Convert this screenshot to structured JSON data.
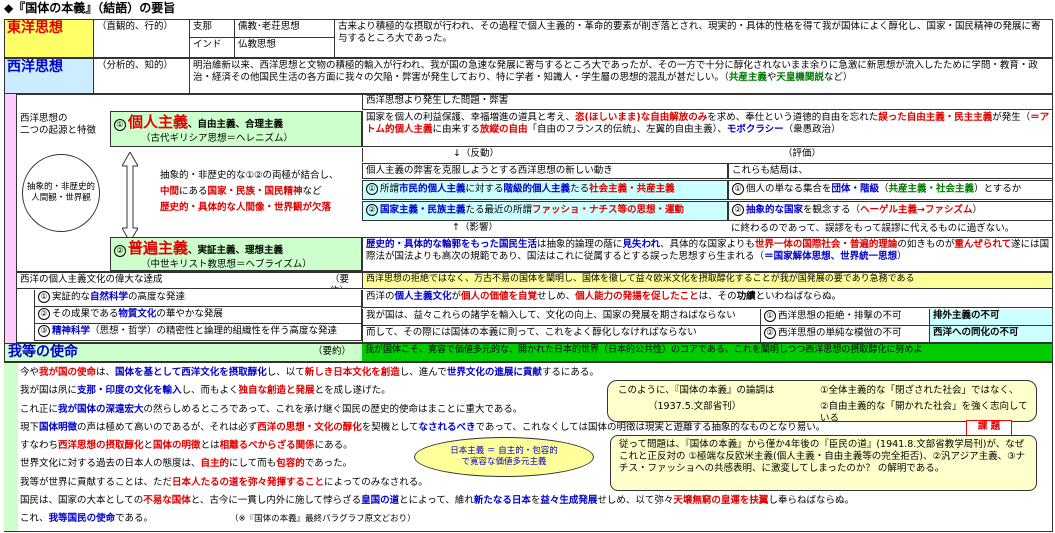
{
  "title": "◆『国体の本義』（結語）の要旨",
  "east": {
    "label": "東洋思想",
    "type": "（直観的、行的）",
    "regions": [
      "支那",
      "インド"
    ],
    "schools": [
      "儒教･老荘思想",
      "仏教思想"
    ],
    "text": "古来より積極的な摂取が行われ、その過程で個人主義的・革命的要素が削ぎ落とされ、現実的・具体的性格を得て我が国体によく醇化し、国家・国民精神の発展に寄与するところ大であった。"
  },
  "west": {
    "label": "西洋思想",
    "type": "（分析的、知的）",
    "text_a": "明治維新以来、西洋思想と文物の積極的輸入が行われ、我が国の急速な発展に寄与するところ大であったが、その一方で十分に醇化されないまま余りに急激に新思想が流入したために学問・教育・政治・経済その他国民生活の各方面に我々の欠陥・弊害が発生しており、特に学者・知識人・学生層の思想的混乱が甚だしい。（",
    "text_b": "共産主義",
    "text_c": "や",
    "text_d": "天皇機関説",
    "text_e": "など）"
  },
  "problems_header": "西洋思想より発生した問題・弊害",
  "origins_label_1": "西洋思想の",
  "origins_label_2": "二つの起源と特徴",
  "circle_text": [
    "抽象的・非歴史的",
    "人間観・世界観"
  ],
  "individualism": {
    "num": "①",
    "name": "個人主義",
    "sub": "、自由主義、合理主義",
    "origin": "（古代ギリシア思想＝ヘレニズム）",
    "problem_a": "国家を個人の利益保護、幸福増進の道具と考え、",
    "problem_b": "恣(ほしいまま)な自由解放のみ",
    "problem_c": "を求め、奉仕という道徳的自由を忘れた",
    "problem_d": "誤った自由主義・民主主義",
    "problem_e": "が発生（",
    "problem_f": "＝アトム的個人主義",
    "problem_g": "に由来する",
    "problem_h": "放縦の自由",
    "problem_i": "「自由のフランス的伝統」、左翼的自由主義）、",
    "problem_j": "モボクラシー",
    "problem_k": "（衆愚政治）"
  },
  "middle": {
    "line1": "抽象的・非歴史的な①②の両極が結合し、",
    "line2a": "中間",
    "line2b": "にある",
    "line2c": "国家・民族・国民精神",
    "line2d": "など",
    "line3a": "歴史的・具体的な人間像・世界観が欠落"
  },
  "reaction": {
    "label": "↓（反動）",
    "sub": "個人主義の弊害を克服しようとする西洋思想の新しい動き",
    "row1_num": "①",
    "row1_a": "所謂",
    "row1_b": "市民的個人主義",
    "row1_c": "に対する",
    "row1_d": "階級的個人主義",
    "row1_e": "たる",
    "row1_f": "社会主義・共産主義",
    "row2_num": "②",
    "row2_a": "国家主義・民族主義",
    "row2_b": "たる最近の所謂",
    "row2_c": "ファッショ・ナチス等の思想・運動",
    "influence": "↑（影響）"
  },
  "evaluation": {
    "label": "（評価）",
    "sub": "これらも結局は、",
    "row1_a": "個人の単なる集合を",
    "row1_b": "団体・階級",
    "row1_c": "（",
    "row1_d": "共産主義・社会主義",
    "row1_e": "）とするか",
    "row2_a": "抽象的な国家",
    "row2_b": "を観念する（",
    "row2_c": "ヘーゲル主義→ファシズム",
    "row2_d": "）",
    "tail": "に終わるのであって、誤謬をもって誤謬に代えるものに過ぎない。"
  },
  "universalism": {
    "num": "②",
    "name": "普遍主義",
    "sub": "、実証主義、理想主義",
    "origin": "（中世キリスト教思想＝ヘブライズム）",
    "p_a": "歴史的・具体的な輪郭をもった",
    "p_b": "国民生活",
    "p_c": "は抽象的論理の蔭に",
    "p_d": "見失われ",
    "p_e": "、具体的な国家よりも",
    "p_f": "世界一体の国際社会・普遍的理論",
    "p_g": "の如きものが",
    "p_h": "重んぜられて",
    "p_i": "遂には国際法が国法よりも高次の規範であり、国法はこれに従属するとする誤った思想すら生まれる（",
    "p_j": "＝国家解体思想、世界統一思想",
    "p_k": "）"
  },
  "culture": {
    "header": "西洋の個人主義文化の偉大な達成",
    "yoyaku": "（要約）",
    "items": [
      {
        "num": "①",
        "a": "実証的な",
        "b": "自然科学",
        "c": "の高度な発達"
      },
      {
        "num": "②",
        "a": "その成果である",
        "b": "物質文化",
        "c": "の華やかな発展"
      },
      {
        "num": "③",
        "a": "精神科学",
        "b": "（思想・哲学）の精密性と論理的組織性を伴う高度な発達",
        "c": ""
      }
    ],
    "right_header": "西洋思想の拒絶ではなく、万古不易の国体を闡明し、国体を徹して益々欧米文化を摂取醇化することが我が国発展の要であり急務である",
    "right_row1_a": "西洋の",
    "right_row1_b": "個人主義文化",
    "right_row1_c": "が",
    "right_row1_d": "個人の価値を自覚",
    "right_row1_e": "せしめ、",
    "right_row1_f": "個人能力の発揚を促したこと",
    "right_row1_g": "は、その",
    "right_row1_h": "功績",
    "right_row1_i": "といわねばならぬ。",
    "right_row2": "我が国は、益々これらの諸学を輸入して、文化の向上、国家の発展を期さねばならない",
    "right_row3": "而して、その際には国体の本義に則って、これをよく醇化しなければならない",
    "bad1_num": "①",
    "bad1": "西洋思想の拒絶・排撃の不可",
    "bad1_r": "排外主義の不可",
    "bad2_num": "②",
    "bad2": "西洋思想の単純な模倣の不可",
    "bad2_r": "西洋への同化の不可"
  },
  "mission": {
    "label": "我等の使命",
    "yoyaku": "（要約）",
    "summary": "我が国体こそ、寛容で価値多元的な、開かれた日本的世界（日本的公共性）のコアである。これを闡明しつつ西洋思想の摂取醇化に努めよ",
    "lines": [
      [
        "今や",
        "我が国の使命",
        "は、",
        "国体を基として西洋文化を摂取醇化",
        "し、以て",
        "新しき日本文化を創造",
        "し、進んで",
        "世界文化の進展に貢献",
        "するにある。"
      ],
      [
        "我が国は夙に",
        "支那・印度の文化を輸入",
        "し、而もよく",
        "独自な創造と発展",
        "とを成し遂げた。"
      ],
      [
        "これ正に",
        "我が国体の深遠宏大",
        "の然らしめるところであって、これを承け継ぐ国民の歴史的使命はまことに重大である。"
      ],
      [
        "現下",
        "国体明徴",
        "の声は極めて高いのであるが、それは必ず",
        "西洋の思想・文化の醇化",
        "を契機として",
        "なされるべき",
        "であって、これなくしては国体の明徴は現実と遊離する抽象的なものとなり易い。"
      ],
      [
        "すなわち",
        "西洋思想の摂取醇化",
        "と",
        "国体の明徴",
        "とは",
        "相離るべからざる関係",
        "にある。"
      ],
      [
        "世界文化に対する過去の日本人の態度は、",
        "自主的",
        "にして而も",
        "包容的",
        "であった。"
      ],
      [
        "我等が世界に貢献することは、ただ",
        "日本人たるの道を弥々発揮すること",
        "によってのみなされる。"
      ],
      [
        "国民は、国家の大本としての",
        "不易な国体",
        "と、古今に一貫し内外に施して悖らざる",
        "皇国の道",
        "とによって、維れ",
        "新たなる日本",
        "を",
        "益々生成発展",
        "せしめ、以て弥々",
        "天壌無窮の皇運を扶翼",
        "し奉らねばならぬ。"
      ],
      [
        "これ、",
        "我等国民の使命",
        "である。"
      ]
    ],
    "note": "（※『国体の本義』最終パラグラフ原文どおり）",
    "bubble_a": "日本主義 ＝ 自主的・包容的",
    "bubble_b": "で寛容な価値多元主義",
    "box1_a": "このように、『国体の本義』の論調は",
    "box1_b": "①全体主義的な「閉ざされた社会」ではなく、",
    "box1_c": "（1937.5.文部省刊）",
    "box1_d": "②自由主義的な「開かれた社会」を強く志向している",
    "kadai": "課 題",
    "box2": "従って問題は、『国体の本義』から僅か4年後の『臣民の道』(1941.8.文部省教学局刊)が、なぜこれと正反対の ①極端な反欧米主義(個人主義・自由主義等の完全拒否)、②汎アジア主義、③ナチス・ファッショへの共感表明、に激変してしまったのか？ の解明である。"
  }
}
